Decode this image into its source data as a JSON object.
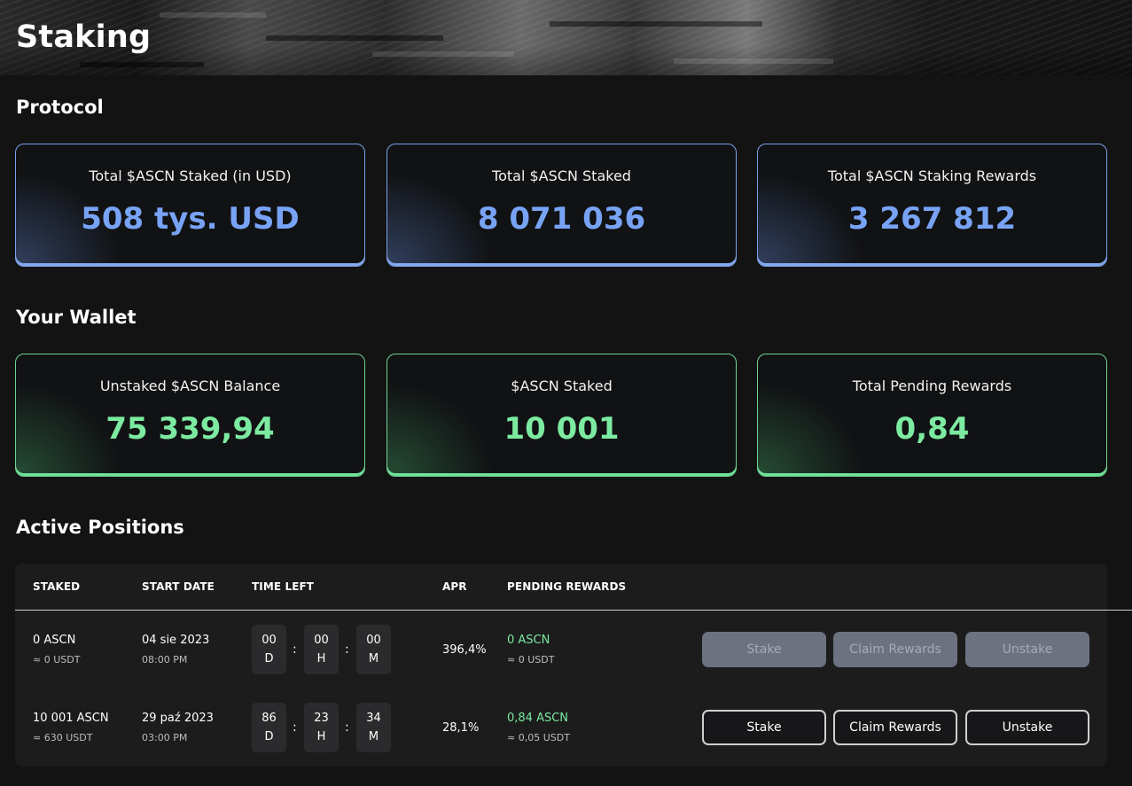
{
  "page": {
    "title": "Staking"
  },
  "protocol": {
    "title": "Protocol",
    "cards": [
      {
        "label": "Total $ASCN Staked (in USD)",
        "value": "508 tys. USD"
      },
      {
        "label": "Total $ASCN Staked",
        "value": "8 071 036"
      },
      {
        "label": "Total $ASCN Staking Rewards",
        "value": "3 267 812"
      }
    ]
  },
  "wallet": {
    "title": "Your Wallet",
    "cards": [
      {
        "label": "Unstaked $ASCN Balance",
        "value": "75 339,94"
      },
      {
        "label": "$ASCN Staked",
        "value": "10 001"
      },
      {
        "label": "Total Pending Rewards",
        "value": "0,84"
      }
    ]
  },
  "positions": {
    "title": "Active Positions",
    "headers": [
      "STAKED",
      "START DATE",
      "TIME LEFT",
      "APR",
      "PENDING REWARDS"
    ],
    "rows": [
      {
        "staked": "0 ASCN",
        "staked_usdt": "≈ 0 USDT",
        "start_date": "04 sie 2023",
        "start_time": "08:00 PM",
        "days": "00",
        "hours": "00",
        "minutes": "00",
        "day_unit": "D",
        "hour_unit": "H",
        "minute_unit": "M",
        "apr": "396,4%",
        "rewards": "0 ASCN",
        "rewards_usdt": "≈ 0 USDT",
        "stake_label": "Stake",
        "claim_label": "Claim Rewards",
        "unstake_label": "Unstake"
      },
      {
        "staked": "10 001 ASCN",
        "staked_usdt": "≈ 630 USDT",
        "start_date": "29 paź 2023",
        "start_time": "03:00 PM",
        "days": "86",
        "hours": "23",
        "minutes": "34",
        "day_unit": "D",
        "hour_unit": "H",
        "minute_unit": "M",
        "apr": "28,1%",
        "rewards": "0,84 ASCN",
        "rewards_usdt": "≈ 0,05 USDT",
        "stake_label": "Stake",
        "claim_label": "Claim Rewards",
        "unstake_label": "Unstake"
      }
    ]
  },
  "colors": {
    "blue_accent": "#78a3f5",
    "green_accent": "#7ceaa0",
    "background": "#131313"
  }
}
